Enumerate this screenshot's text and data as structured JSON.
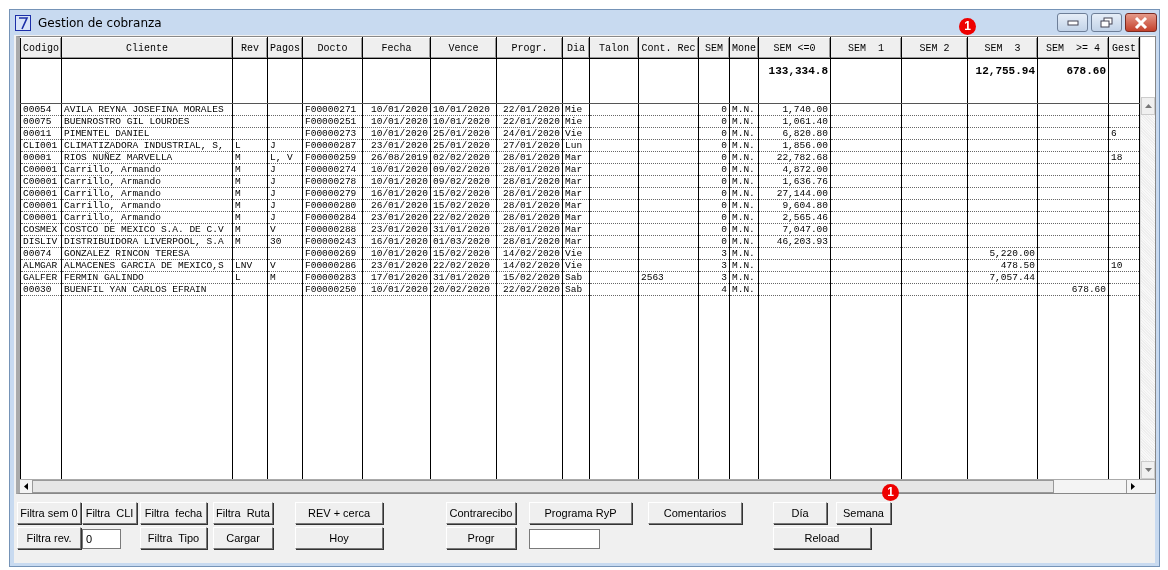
{
  "window": {
    "title": "Gestion de cobranza"
  },
  "table": {
    "columns": [
      {
        "label": "Codigo"
      },
      {
        "label": "Cliente"
      },
      {
        "label": "Rev"
      },
      {
        "label": "Pagos"
      },
      {
        "label": "Docto"
      },
      {
        "label": "Fecha"
      },
      {
        "label": "Vence"
      },
      {
        "label": "Progr."
      },
      {
        "label": "Dia"
      },
      {
        "label": "Talon"
      },
      {
        "label": "Cont. Rec"
      },
      {
        "label": "SEM"
      },
      {
        "label": "Mone"
      },
      {
        "label": "SEM <=0",
        "total": "133,334.8"
      },
      {
        "label": "SEM  1"
      },
      {
        "label": "SEM 2"
      },
      {
        "label": "SEM  3",
        "badge": "1",
        "total": "12,755.94"
      },
      {
        "label": "SEM  >= 4",
        "total": "678.60"
      },
      {
        "label": "Gest"
      }
    ],
    "rows": [
      {
        "codigo": "00054",
        "cliente": "AVILA REYNA JOSEFINA MORALES",
        "docto": "F00000271",
        "fecha": "10/01/2020",
        "vence": "10/01/2020",
        "progr": "22/01/2020",
        "dia": "Mie",
        "sem": "0",
        "mone": "M.N.",
        "sem_le0": "1,740.00"
      },
      {
        "codigo": "00075",
        "cliente": "BUENROSTRO GIL LOURDES",
        "docto": "F00000251",
        "fecha": "10/01/2020",
        "vence": "10/01/2020",
        "progr": "22/01/2020",
        "dia": "Mie",
        "sem": "0",
        "mone": "M.N.",
        "sem_le0": "1,061.40"
      },
      {
        "codigo": "00011",
        "cliente": "PIMENTEL DANIEL",
        "docto": "F00000273",
        "fecha": "10/01/2020",
        "vence": "25/01/2020",
        "progr": "24/01/2020",
        "dia": "Vie",
        "sem": "0",
        "mone": "M.N.",
        "sem_le0": "6,820.80",
        "gest": "6"
      },
      {
        "codigo": "CLI001",
        "cliente": "CLIMATIZADORA INDUSTRIAL, S,",
        "rev": "L",
        "pagos": "J",
        "docto": "F00000287",
        "fecha": "23/01/2020",
        "vence": "25/01/2020",
        "progr": "27/01/2020",
        "dia": "Lun",
        "sem": "0",
        "mone": "M.N.",
        "sem_le0": "1,856.00"
      },
      {
        "codigo": "00001",
        "cliente": "RIOS NUÑEZ MARVELLA",
        "rev": "M",
        "pagos": "L, V",
        "docto": "F00000259",
        "fecha": "26/08/2019",
        "vence": "02/02/2020",
        "progr": "28/01/2020",
        "dia": "Mar",
        "sem": "0",
        "mone": "M.N.",
        "sem_le0": "22,782.68",
        "gest": "18"
      },
      {
        "codigo": "C00001",
        "cliente": "Carrillo, Armando",
        "rev": "M",
        "pagos": "J",
        "docto": "F00000274",
        "fecha": "10/01/2020",
        "vence": "09/02/2020",
        "progr": "28/01/2020",
        "dia": "Mar",
        "sem": "0",
        "mone": "M.N.",
        "sem_le0": "4,872.00"
      },
      {
        "codigo": "C00001",
        "cliente": "Carrillo, Armando",
        "rev": "M",
        "pagos": "J",
        "docto": "F00000278",
        "fecha": "10/01/2020",
        "vence": "09/02/2020",
        "progr": "28/01/2020",
        "dia": "Mar",
        "sem": "0",
        "mone": "M.N.",
        "sem_le0": "1,636.76"
      },
      {
        "codigo": "C00001",
        "cliente": "Carrillo, Armando",
        "rev": "M",
        "pagos": "J",
        "docto": "F00000279",
        "fecha": "16/01/2020",
        "vence": "15/02/2020",
        "progr": "28/01/2020",
        "dia": "Mar",
        "sem": "0",
        "mone": "M.N.",
        "sem_le0": "27,144.00"
      },
      {
        "codigo": "C00001",
        "cliente": "Carrillo, Armando",
        "rev": "M",
        "pagos": "J",
        "docto": "F00000280",
        "fecha": "26/01/2020",
        "vence": "15/02/2020",
        "progr": "28/01/2020",
        "dia": "Mar",
        "sem": "0",
        "mone": "M.N.",
        "sem_le0": "9,604.80"
      },
      {
        "codigo": "C00001",
        "cliente": "Carrillo, Armando",
        "rev": "M",
        "pagos": "J",
        "docto": "F00000284",
        "fecha": "23/01/2020",
        "vence": "22/02/2020",
        "progr": "28/01/2020",
        "dia": "Mar",
        "sem": "0",
        "mone": "M.N.",
        "sem_le0": "2,565.46"
      },
      {
        "codigo": "COSMEX",
        "cliente": "COSTCO DE MEXICO S.A. DE C.V",
        "rev": "M",
        "pagos": "V",
        "docto": "F00000288",
        "fecha": "23/01/2020",
        "vence": "31/01/2020",
        "progr": "28/01/2020",
        "dia": "Mar",
        "sem": "0",
        "mone": "M.N.",
        "sem_le0": "7,047.00"
      },
      {
        "codigo": "DISLIV",
        "cliente": "DISTRIBUIDORA LIVERPOOL, S.A",
        "rev": "M",
        "pagos": "30",
        "docto": "F00000243",
        "fecha": "16/01/2020",
        "vence": "01/03/2020",
        "progr": "28/01/2020",
        "dia": "Mar",
        "sem": "0",
        "mone": "M.N.",
        "sem_le0": "46,203.93"
      },
      {
        "codigo": "00074",
        "cliente": "GONZALEZ RINCON TERESA",
        "docto": "F00000269",
        "fecha": "10/01/2020",
        "vence": "15/02/2020",
        "progr": "14/02/2020",
        "dia": "Vie",
        "sem": "3",
        "mone": "M.N.",
        "sem_3": "5,220.00"
      },
      {
        "codigo": "ALMGAR",
        "cliente": "ALMACENES GARCIA DE MEXICO,S",
        "rev": "LNV",
        "pagos": "V",
        "docto": "F00000286",
        "fecha": "23/01/2020",
        "vence": "22/02/2020",
        "progr": "14/02/2020",
        "dia": "Vie",
        "sem": "3",
        "mone": "M.N.",
        "sem_3": "478.50",
        "gest": "10"
      },
      {
        "codigo": "GALFER",
        "cliente": "FERMIN GALINDO",
        "rev": "L",
        "pagos": "M",
        "docto": "F00000283",
        "fecha": "17/01/2020",
        "vence": "31/01/2020",
        "progr": "15/02/2020",
        "dia": "Sab",
        "cont_rec": "2563",
        "sem": "3",
        "mone": "M.N.",
        "sem_3": "7,057.44"
      },
      {
        "codigo": "00030",
        "cliente": "BUENFIL YAN CARLOS EFRAIN",
        "docto": "F00000250",
        "fecha": "10/01/2020",
        "vence": "20/02/2020",
        "progr": "22/02/2020",
        "dia": "Sab",
        "sem": "4",
        "mone": "M.N.",
        "sem_ge4": "678.60"
      }
    ]
  },
  "controls": [
    {
      "kind": "button",
      "label": "Filtra sem 0"
    },
    {
      "kind": "button",
      "label": "Filtra  CLI"
    },
    {
      "kind": "button",
      "label": "Filtra  fecha"
    },
    {
      "kind": "button",
      "label": "Filtra  Ruta"
    },
    {
      "kind": "button",
      "label": "REV + cerca"
    },
    {
      "kind": "button",
      "label": "Contrarecibo"
    },
    {
      "kind": "button",
      "label": "Programa RyP"
    },
    {
      "kind": "button",
      "label": "Comentarios"
    },
    {
      "kind": "button",
      "label": "Día"
    },
    {
      "kind": "button",
      "label": "Semana",
      "badge": "1"
    },
    {
      "kind": "button",
      "label": "Filtra rev."
    },
    {
      "kind": "input",
      "value": "0"
    },
    {
      "kind": "button",
      "label": "Filtra  Tipo"
    },
    {
      "kind": "button",
      "label": "Cargar"
    },
    {
      "kind": "button",
      "label": "Hoy"
    },
    {
      "kind": "button",
      "label": "Progr"
    },
    {
      "kind": "input"
    },
    {
      "kind": "button",
      "label": "Reload"
    }
  ]
}
